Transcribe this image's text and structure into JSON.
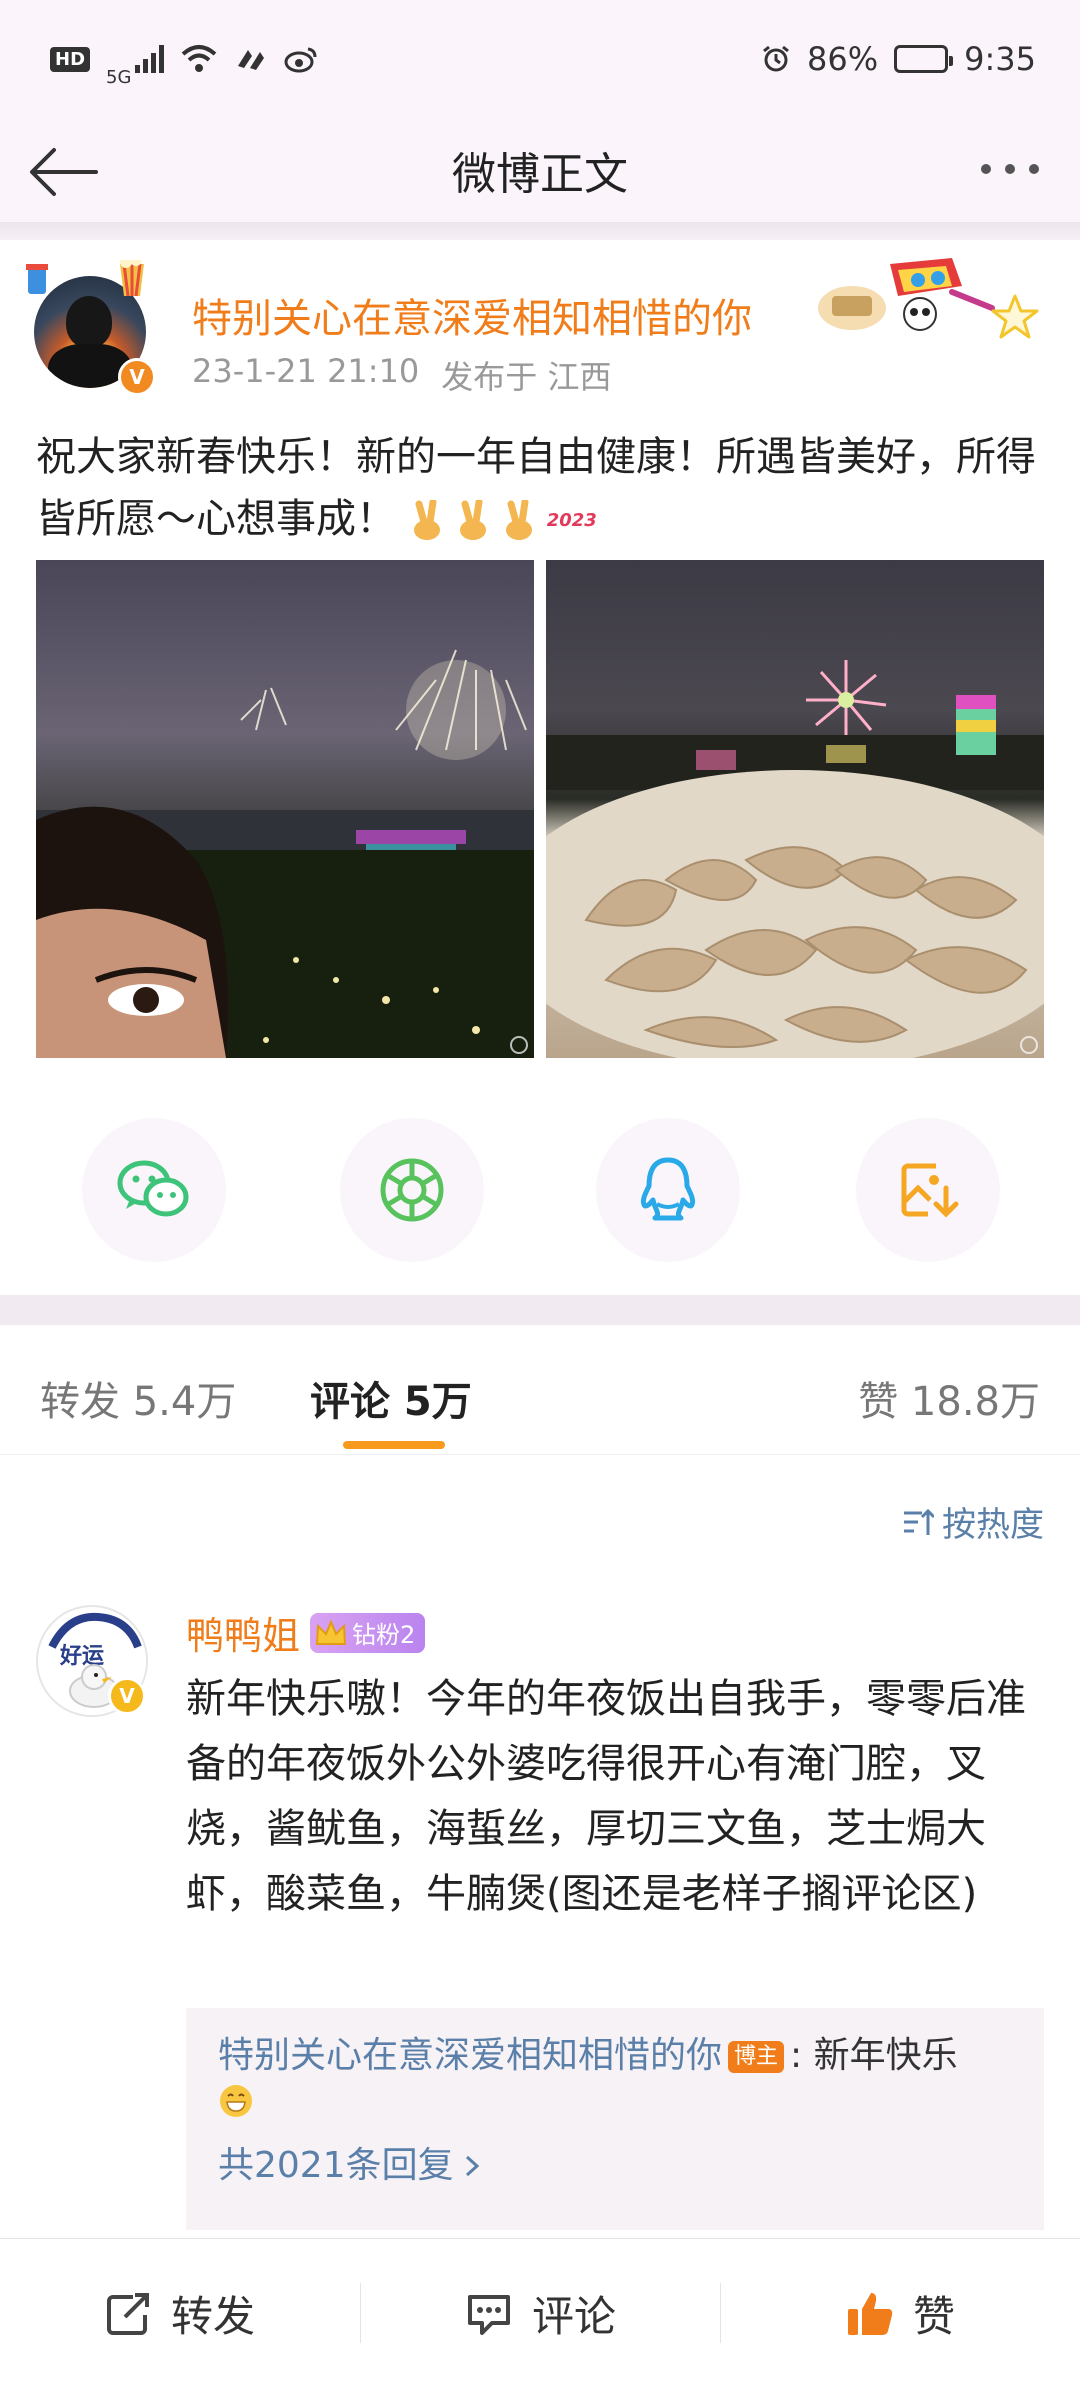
{
  "status_bar": {
    "network_badge": "HD",
    "network_type": "5G",
    "battery": "86%",
    "battery_level": 0.86,
    "time": "9:35"
  },
  "nav": {
    "title": "微博正文"
  },
  "post": {
    "username": "特别关心在意深爱相知相惜的你",
    "date": "23-1-21 21:10",
    "location": "发布于 江西",
    "text": "祝大家新春快乐！新的一年自由健康！所遇皆美好，所得皆所愿～心想事成！",
    "emoji_tag": "2023",
    "images": [
      "selfie-with-fireworks",
      "dumplings-with-fireworks"
    ],
    "share_targets": [
      "wechat",
      "moments",
      "qq",
      "save-image"
    ]
  },
  "tabs": {
    "repost": "转发 5.4万",
    "comment": "评论 5万",
    "like": "赞 18.8万"
  },
  "comments": {
    "sort_label": "按热度",
    "items": [
      {
        "name": "鸭鸭姐",
        "fan_badge": "钻粉2",
        "text": "新年快乐嗷！今年的年夜饭出自我手，零零后准备的年夜饭外公外婆吃得很开心有淹门腔，叉烧，酱鱿鱼，海蜇丝，厚切三文鱼，芝士焗大虾，酸菜鱼，牛腩煲(图还是老样子搁评论区)",
        "reply": {
          "author": "特别关心在意深爱相知相惜的你",
          "author_tag": "博主",
          "text": ": 新年快乐",
          "more": "共2021条回复"
        }
      }
    ]
  },
  "bottom_bar": {
    "repost": "转发",
    "comment": "评论",
    "like": "赞"
  },
  "colors": {
    "accent_orange": "#f07d1a",
    "link_blue": "#5a7fa8",
    "tab_indicator": "#f79a1d"
  }
}
